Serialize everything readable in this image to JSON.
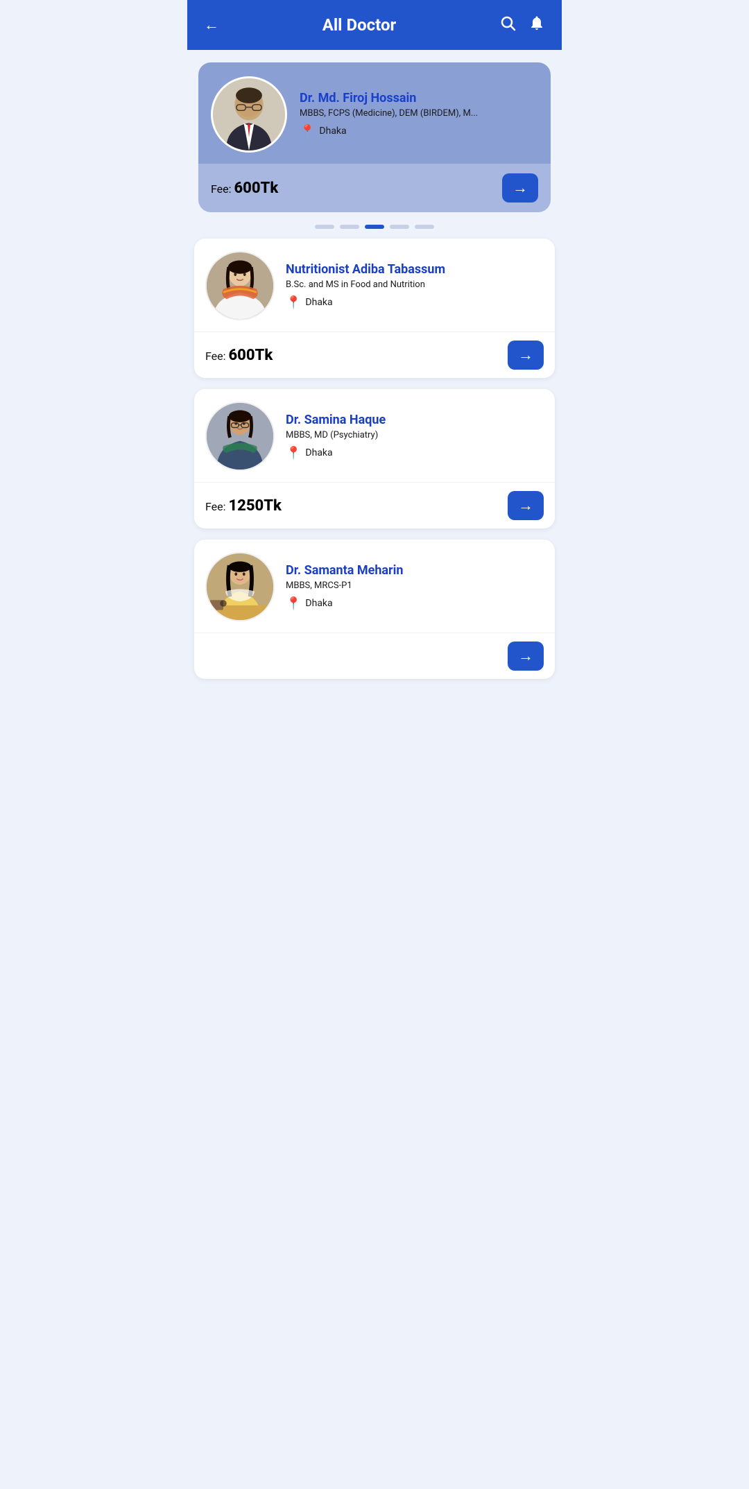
{
  "header": {
    "title": "All Doctor",
    "back_icon": "←",
    "search_icon": "🔍",
    "bell_icon": "🔔"
  },
  "featured_doctor": {
    "name": "Dr. Md. Firoj Hossain",
    "qualification": "MBBS, FCPS (Medicine), DEM (BIRDEM), M...",
    "location": "Dhaka",
    "fee": "600Tk",
    "fee_label": "Fee:"
  },
  "pagination": {
    "dots": [
      0,
      1,
      2,
      3,
      4
    ],
    "active": 2
  },
  "doctors": [
    {
      "id": 1,
      "name": "Nutritionist Adiba Tabassum",
      "qualification": "B.Sc.  and MS in Food and Nutrition",
      "location": "Dhaka",
      "fee": "600Tk",
      "fee_label": "Fee:",
      "avatar_bg": "bg-warm"
    },
    {
      "id": 2,
      "name": "Dr. Samina Haque",
      "qualification": "MBBS, MD (Psychiatry)",
      "location": "Dhaka",
      "fee": "1250Tk",
      "fee_label": "Fee:",
      "avatar_bg": "bg-blue"
    },
    {
      "id": 3,
      "name": "Dr. Samanta Meharin",
      "qualification": "MBBS, MRCS-P1",
      "location": "Dhaka",
      "fee": "",
      "fee_label": "",
      "avatar_bg": "bg-tan"
    }
  ],
  "arrow_label": "→"
}
